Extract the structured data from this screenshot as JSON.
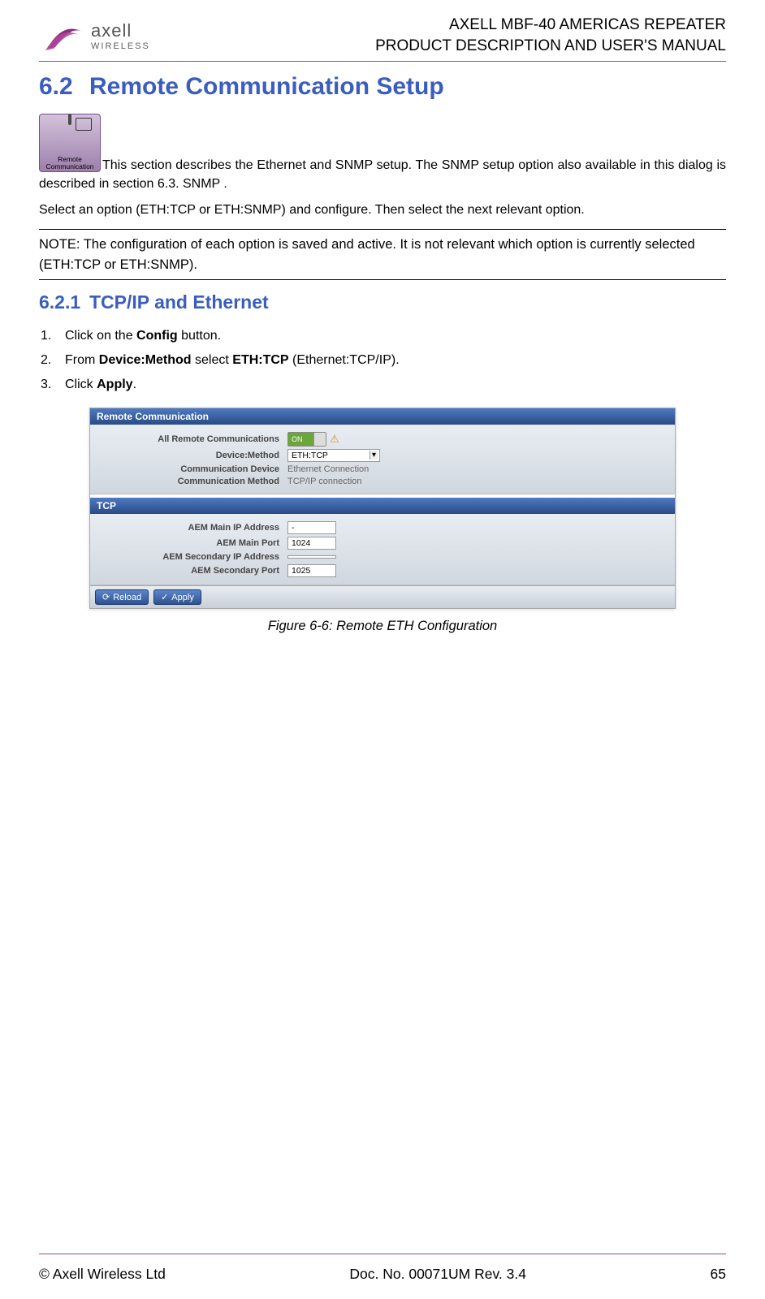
{
  "header": {
    "logo_brand": "axell",
    "logo_sub": "WIRELESS",
    "title1": "AXELL MBF-40 AMERICAS REPEATER",
    "title2": "PRODUCT DESCRIPTION AND USER'S MANUAL"
  },
  "section": {
    "num": "6.2",
    "title": "Remote Communication Setup",
    "icon_label": "Remote Communication",
    "intro1": "This section describes the Ethernet and SNMP setup. The SNMP setup option also available in this dialog is described in section 6.3. SNMP .",
    "intro2": "Select an option (ETH:TCP or ETH:SNMP) and configure. Then select the next relevant option.",
    "note": "NOTE: The configuration of each option is saved and active. It is not relevant which option is currently selected (ETH:TCP or ETH:SNMP)."
  },
  "subsection": {
    "num": "6.2.1",
    "title": "TCP/IP and Ethernet",
    "steps": [
      {
        "pre": "Click on the ",
        "b": "Config",
        "post": " button."
      },
      {
        "pre": "From ",
        "b": "Device:Method",
        "mid": " select ",
        "b2": "ETH:TCP",
        "post": " (Ethernet:TCP/IP)."
      },
      {
        "pre": "Click ",
        "b": "Apply",
        "post": "."
      }
    ]
  },
  "screenshot": {
    "panel_title": "Remote Communication",
    "rows": {
      "all_remote_label": "All Remote Communications",
      "all_remote_toggle": "ON",
      "device_method_label": "Device:Method",
      "device_method_value": "ETH:TCP",
      "comm_device_label": "Communication Device",
      "comm_device_value": "Ethernet Connection",
      "comm_method_label": "Communication Method",
      "comm_method_value": "TCP/IP connection"
    },
    "tcp_title": "TCP",
    "tcp": {
      "main_ip_label": "AEM Main IP Address",
      "main_ip_value": "-",
      "main_port_label": "AEM Main Port",
      "main_port_value": "1024",
      "sec_ip_label": "AEM Secondary IP Address",
      "sec_ip_value": "",
      "sec_port_label": "AEM Secondary Port",
      "sec_port_value": "1025"
    },
    "buttons": {
      "reload": "Reload",
      "apply": "Apply"
    }
  },
  "figure_caption": "Figure 6-6:  Remote ETH Configuration",
  "footer": {
    "left": "© Axell Wireless Ltd",
    "center": "Doc. No. 00071UM Rev. 3.4",
    "right": "65"
  }
}
